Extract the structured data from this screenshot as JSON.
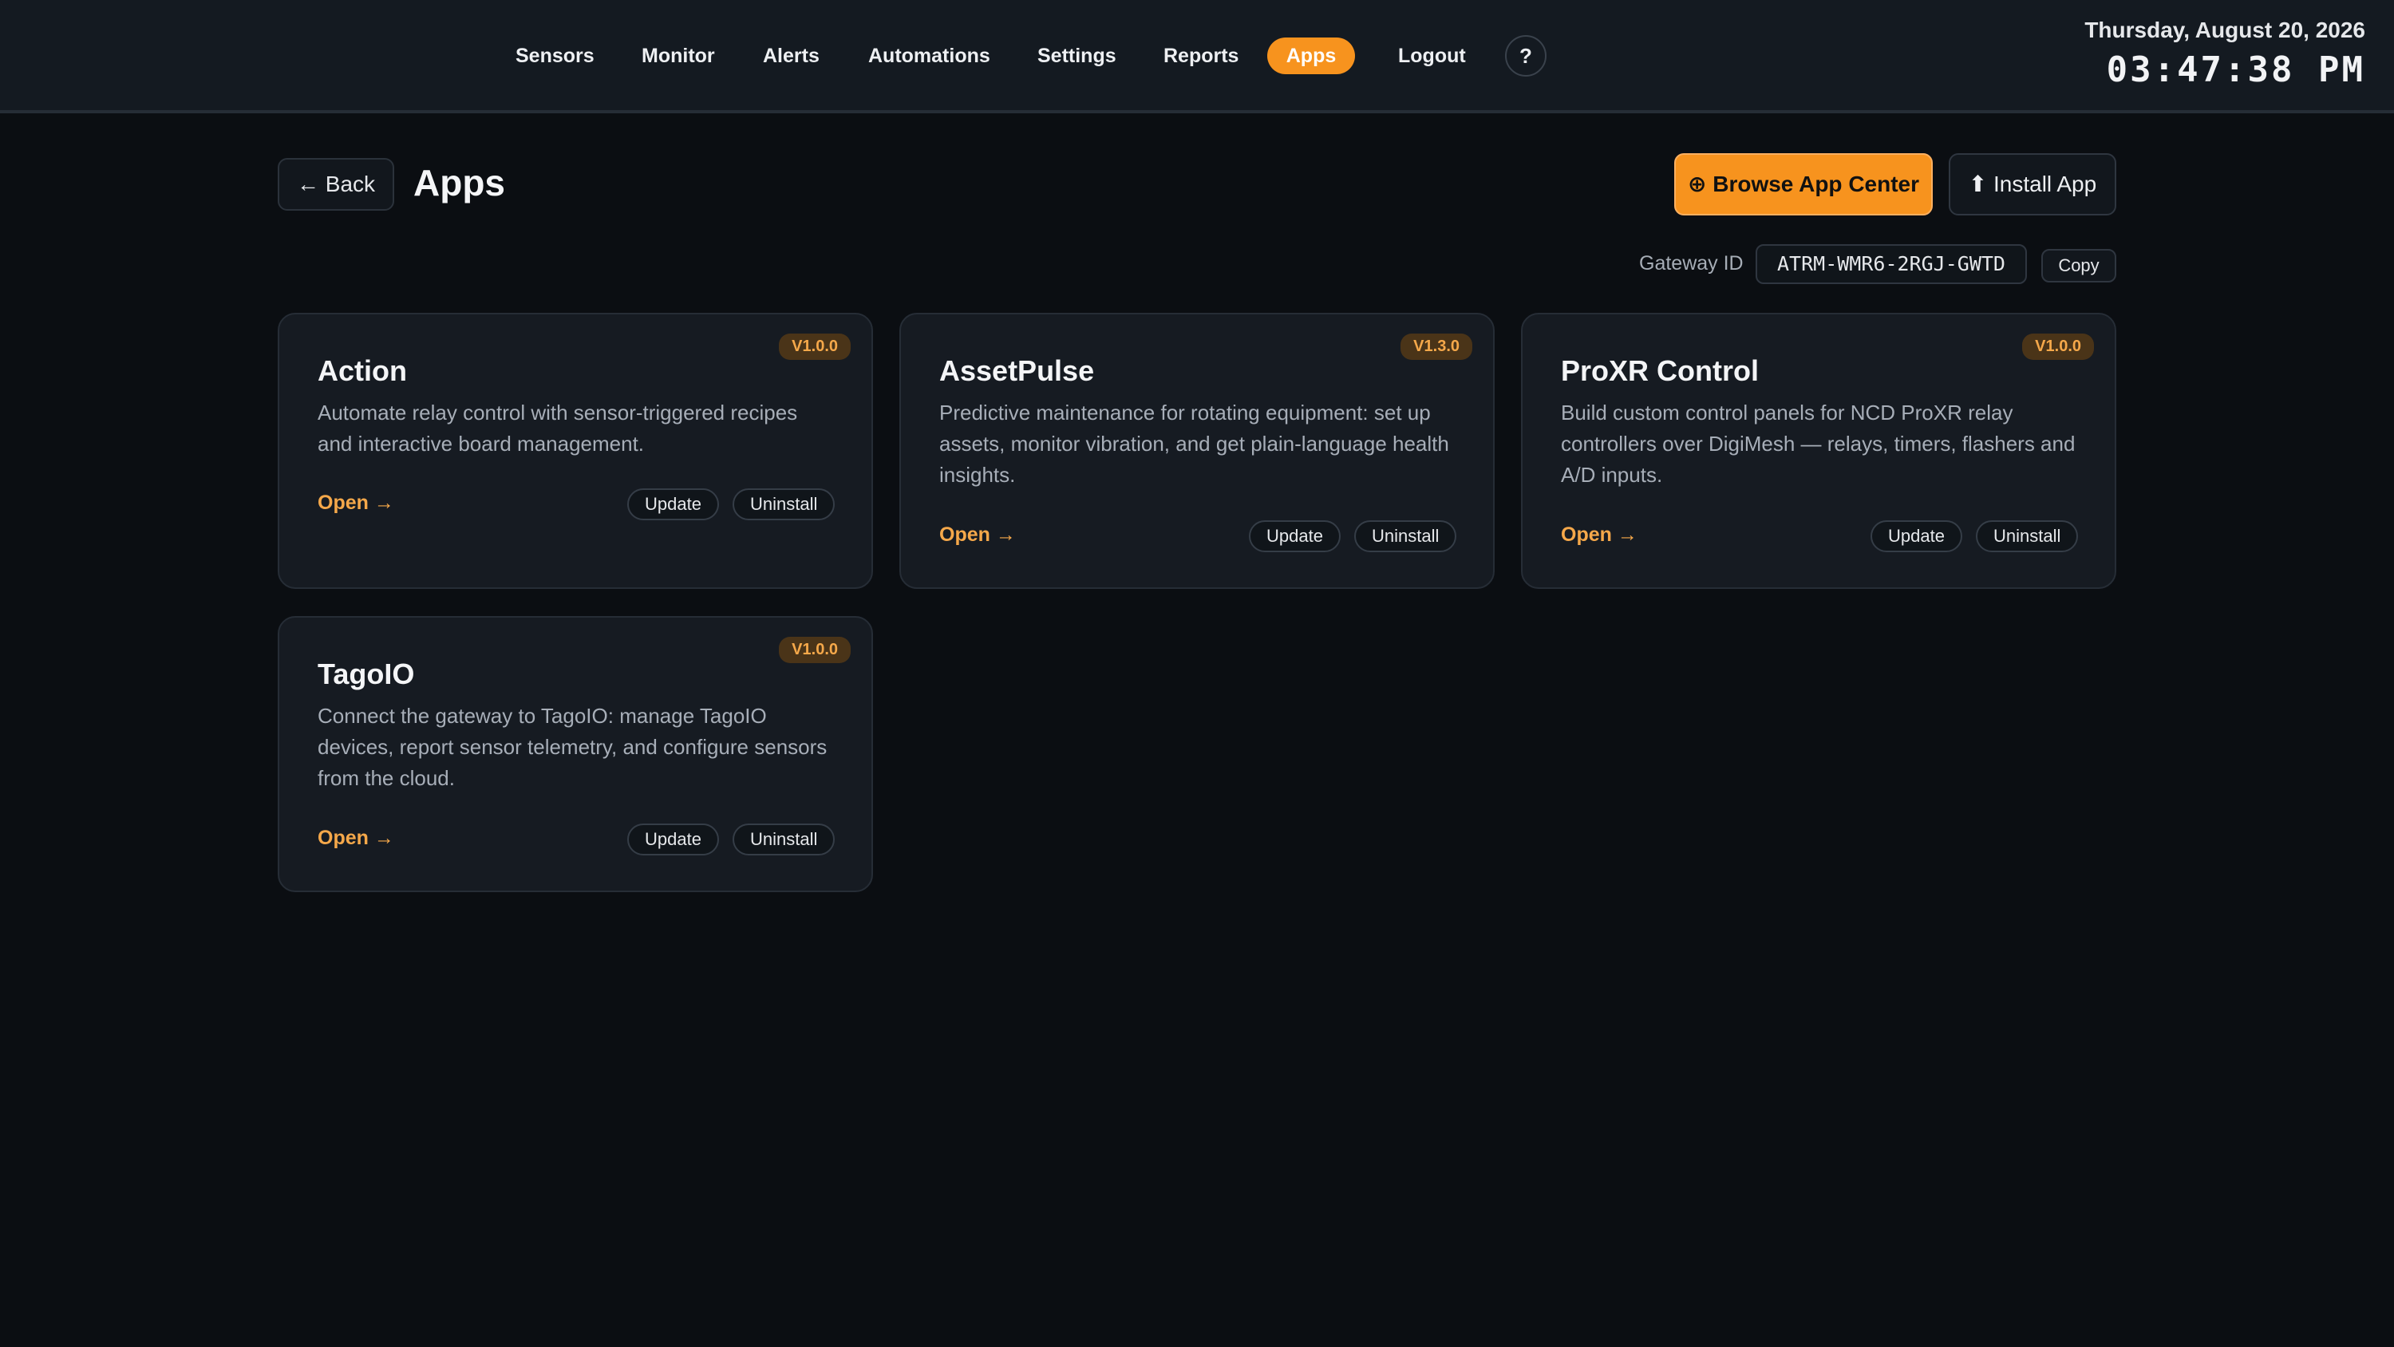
{
  "nav": {
    "items": [
      {
        "label": "Sensors"
      },
      {
        "label": "Monitor"
      },
      {
        "label": "Alerts"
      },
      {
        "label": "Automations"
      },
      {
        "label": "Settings"
      },
      {
        "label": "Reports"
      },
      {
        "label": "Apps",
        "active": true
      },
      {
        "label": "Logout"
      }
    ],
    "help_label": "?"
  },
  "clock": {
    "date": "Thursday, August 20, 2026",
    "time": "03:47:38 PM"
  },
  "header": {
    "back_label": "← Back",
    "title": "Apps",
    "browse_label": "⊕ Browse App Center",
    "install_label": "⬆ Install App"
  },
  "gateway": {
    "label": "Gateway ID",
    "value": "ATRM-WMR6-2RGJ-GWTD",
    "copy_label": "Copy"
  },
  "apps": [
    {
      "name": "Action",
      "version": "V1.0.0",
      "description": "Automate relay control with sensor-triggered recipes and interactive board management.",
      "open_label": "Open →",
      "update_label": "Update",
      "uninstall_label": "Uninstall"
    },
    {
      "name": "AssetPulse",
      "version": "V1.3.0",
      "description": "Predictive maintenance for rotating equipment: set up assets, monitor vibration, and get plain-language health insights.",
      "open_label": "Open →",
      "update_label": "Update",
      "uninstall_label": "Uninstall"
    },
    {
      "name": "ProXR Control",
      "version": "V1.0.0",
      "description": "Build custom control panels for NCD ProXR relay controllers over DigiMesh — relays, timers, flashers and A/D inputs.",
      "open_label": "Open →",
      "update_label": "Update",
      "uninstall_label": "Uninstall"
    },
    {
      "name": "TagoIO",
      "version": "V1.0.0",
      "description": "Connect the gateway to TagoIO: manage TagoIO devices, report sensor telemetry, and configure sensors from the cloud.",
      "open_label": "Open →",
      "update_label": "Update",
      "uninstall_label": "Uninstall"
    }
  ],
  "colors": {
    "accent": "#f7931e",
    "background": "#0b0e12",
    "card": "#161b22"
  }
}
